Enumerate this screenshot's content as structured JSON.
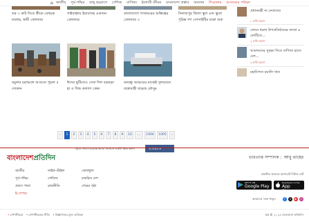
{
  "topnav": {
    "items": [
      "জাতীয়",
      "পূর্ব-পশ্চিম",
      "তাহ্ ছয়রাগে",
      "পেশিজ",
      "বাণিজ্য",
      "ইংলাবী জীবন",
      "বাংলাদেশ প্রস্তাব",
      "অন্যান্য",
      "শিরোনাম",
      "আজকের পত্রিকা"
    ],
    "home_icon": "home-icon"
  },
  "cards": [
    {
      "title": "তর ৩ কাট দিতে স্ত্রীকে বেধড়ক মারধর, স্বামী গ্রেফতার"
    },
    {
      "title": "গাইবান্ধায় ইয়াবাসহ একজন গ্রেফতার"
    },
    {
      "title": "বাংলাদেশে গণকবরের অস্তিত্বের গ্রেফতার ৩"
    },
    {
      "title": "দিনাজপুর জিলা স্কুল এন্ড স্কুলে পূরিন্ত গণ সোসাইটির যাত্রা শুরু"
    },
    {
      "title": "যমুনার চরাঞ্চলে আগুনে পুড়ল ৫ দোকান"
    },
    {
      "title": "ঈদের ছুটিতেও সেবা দিল বড়ছড়া হা ও শিশু কল্যাণ কেন্দ্র"
    },
    {
      "title": "বনবন্ধু আঞ্চয়ের মাঝেই সুন্দরবনে যাত্রাবাহী বাড়ছে মৌসুম"
    }
  ],
  "sidebar": [
    {
      "text": "প্রধানমন্ত্রী না নেতাদের",
      "meta": "১ ঘণ্টা আগে"
    },
    {
      "text": "ফোনে ধরলা উপপ্রতিষ্ঠানের তাজা ৬ কোটিতে...",
      "meta": "২ ঘণ্টা আগে"
    },
    {
      "text": "আমানতের সুরক্ষা দিতে বাণিজ্য হাতে বেশ...",
      "meta": "৩ ঘণ্টা আগে"
    },
    {
      "text": "মহাবিপদে রয়ালি খাত",
      "meta": ""
    }
  ],
  "pagination": {
    "pages": [
      "‹",
      "1",
      "2",
      "3",
      "4",
      "5",
      "6",
      "7",
      "8",
      "9",
      "10",
      "...",
      "1004",
      "1005",
      "›"
    ],
    "active": "1"
  },
  "jump": {
    "label": "পৃষ্ঠায় সংবাদ রয়েছে কারো জানতে একটা ক্লিক করুন",
    "select_value": "আর্কাইভ ▾"
  },
  "footer": {
    "logo_red": "বাংলাদেশ",
    "logo_green": "প্রতিদিন",
    "editor_label": "ভারপ্রাপ্ত সম্পাদক :",
    "editor_name": "আবু তাহের",
    "links_col1": [
      "জাতীয়",
      "পূর্ব-পশ্চিম",
      "প্রবাস পাতা",
      "ই-পেপার"
    ],
    "links_col2": [
      "লাইফ স্টাইল",
      "শোবিজ",
      "রাজনীতি"
    ],
    "links_col3": [
      "খেলাধুলা",
      "চাকরিত দেশ",
      "শেষের পৃষ্ঠা"
    ],
    "contact_text": "প্রকাশিত ক্যানেল আপডেট নিউজ নেট",
    "google_small": "GET IT ON",
    "google_big": "Google Play",
    "apple_small": "Download on the",
    "apple_big": "App Store",
    "follow_text": "আমাদের সঙ্গে থাকুন",
    "bottom_links": [
      "গোপনীয়তা",
      "গোপনীয়তার নীতি",
      "বিজ্ঞাপনের মূল্য তালিকা"
    ],
    "copyright": "স্বত্ব © ২০২৪ বাংলাদেশ প্রতিদিন"
  }
}
